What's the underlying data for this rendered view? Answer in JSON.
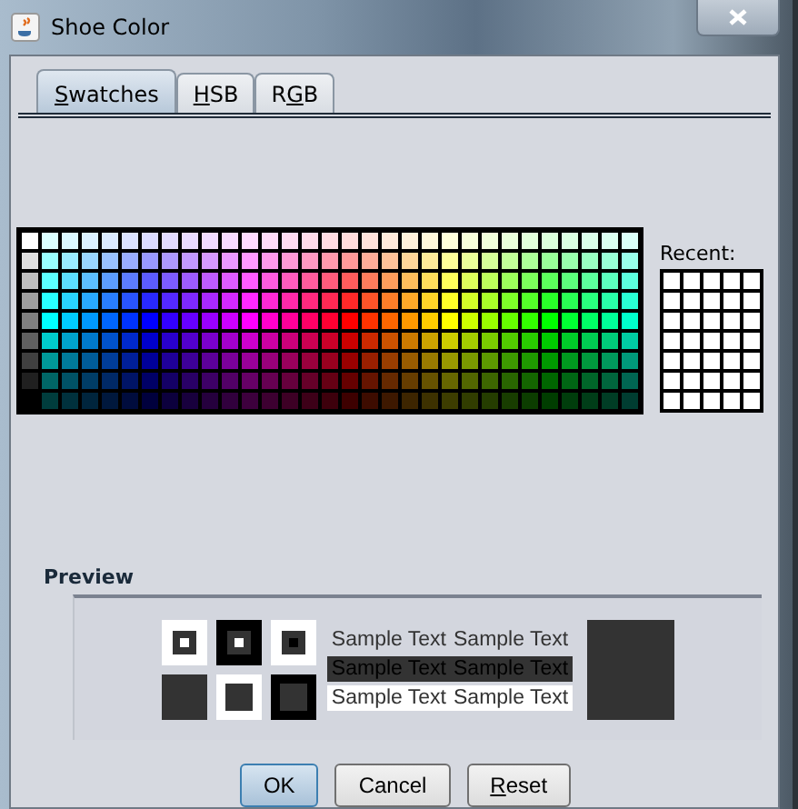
{
  "window": {
    "title": "Shoe Color"
  },
  "tabs": [
    {
      "label_parts": [
        {
          "text": "S",
          "underlined": true
        },
        {
          "text": "watches",
          "underlined": false
        }
      ],
      "selected": true
    },
    {
      "label_parts": [
        {
          "text": "H",
          "underlined": true
        },
        {
          "text": "SB",
          "underlined": false
        }
      ],
      "selected": false
    },
    {
      "label_parts": [
        {
          "text": "R",
          "underlined": false
        },
        {
          "text": "G",
          "underlined": true
        },
        {
          "text": "B",
          "underlined": false
        }
      ],
      "selected": false
    }
  ],
  "recent": {
    "label": "Recent:"
  },
  "preview": {
    "label": "Preview",
    "color": "#333333",
    "samples": [
      "Sample Text",
      "Sample Text",
      "Sample Text",
      "Sample Text",
      "Sample Text",
      "Sample Text"
    ]
  },
  "buttons": [
    {
      "label_parts": [
        {
          "text": "OK",
          "underlined": false
        }
      ],
      "default": true
    },
    {
      "label_parts": [
        {
          "text": "Cancel",
          "underlined": false
        }
      ],
      "default": false
    },
    {
      "label_parts": [
        {
          "text": "R",
          "underlined": true
        },
        {
          "text": "eset",
          "underlined": false
        }
      ],
      "default": false
    }
  ]
}
